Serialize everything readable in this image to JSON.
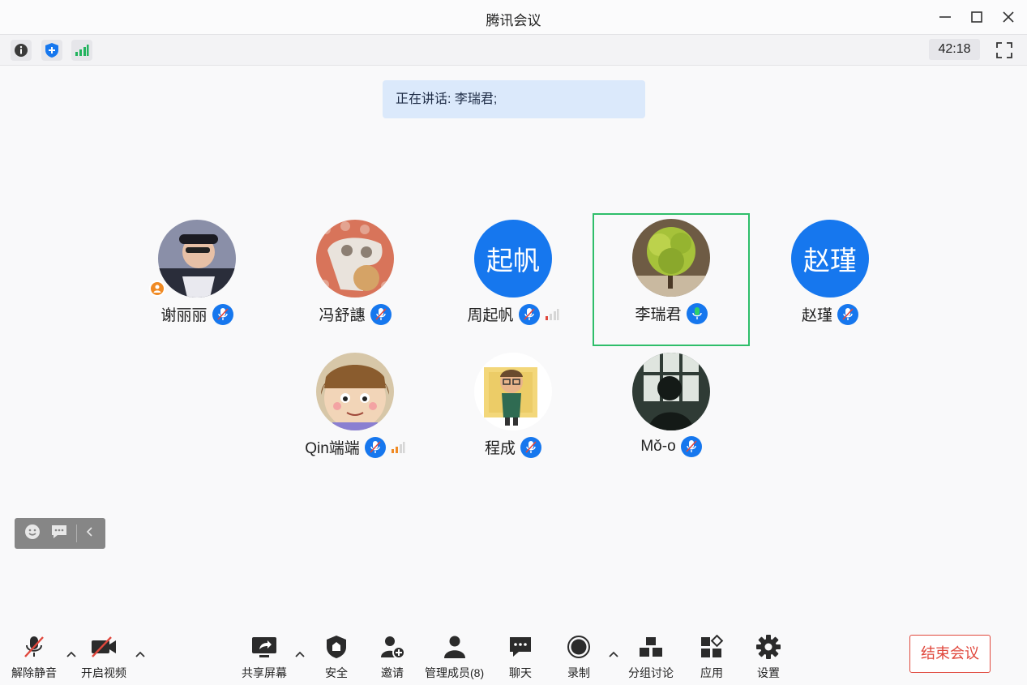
{
  "window": {
    "title": "腾讯会议",
    "timer": "42:18"
  },
  "speaking": {
    "text": "正在讲话: 李瑞君;"
  },
  "participants": [
    {
      "name": "谢丽丽",
      "avatar_text": "",
      "host": true,
      "signal": ""
    },
    {
      "name": "冯舒譓",
      "avatar_text": "",
      "signal": ""
    },
    {
      "name": "周起帆",
      "avatar_text": "起帆",
      "signal": "weak"
    },
    {
      "name": "李瑞君",
      "avatar_text": "",
      "speaking": true,
      "signal": ""
    },
    {
      "name": "赵瑾",
      "avatar_text": "赵瑾",
      "signal": ""
    },
    {
      "name": "Qin端端",
      "avatar_text": "",
      "signal": "medium"
    },
    {
      "name": "程成",
      "avatar_text": "",
      "signal": ""
    },
    {
      "name": "Mǒ-o",
      "avatar_text": "",
      "signal": ""
    }
  ],
  "toolbar": {
    "unmute": "解除静音",
    "video": "开启视频",
    "share": "共享屏幕",
    "security": "安全",
    "invite": "邀请",
    "members": "管理成员(8)",
    "chat": "聊天",
    "record": "录制",
    "breakout": "分组讨论",
    "apps": "应用",
    "settings": "设置",
    "end": "结束会议"
  },
  "colors": {
    "accent": "#1677ee",
    "speaking_border": "#2fbe6a",
    "end_red": "#e0473c",
    "host_orange": "#f08a24"
  }
}
